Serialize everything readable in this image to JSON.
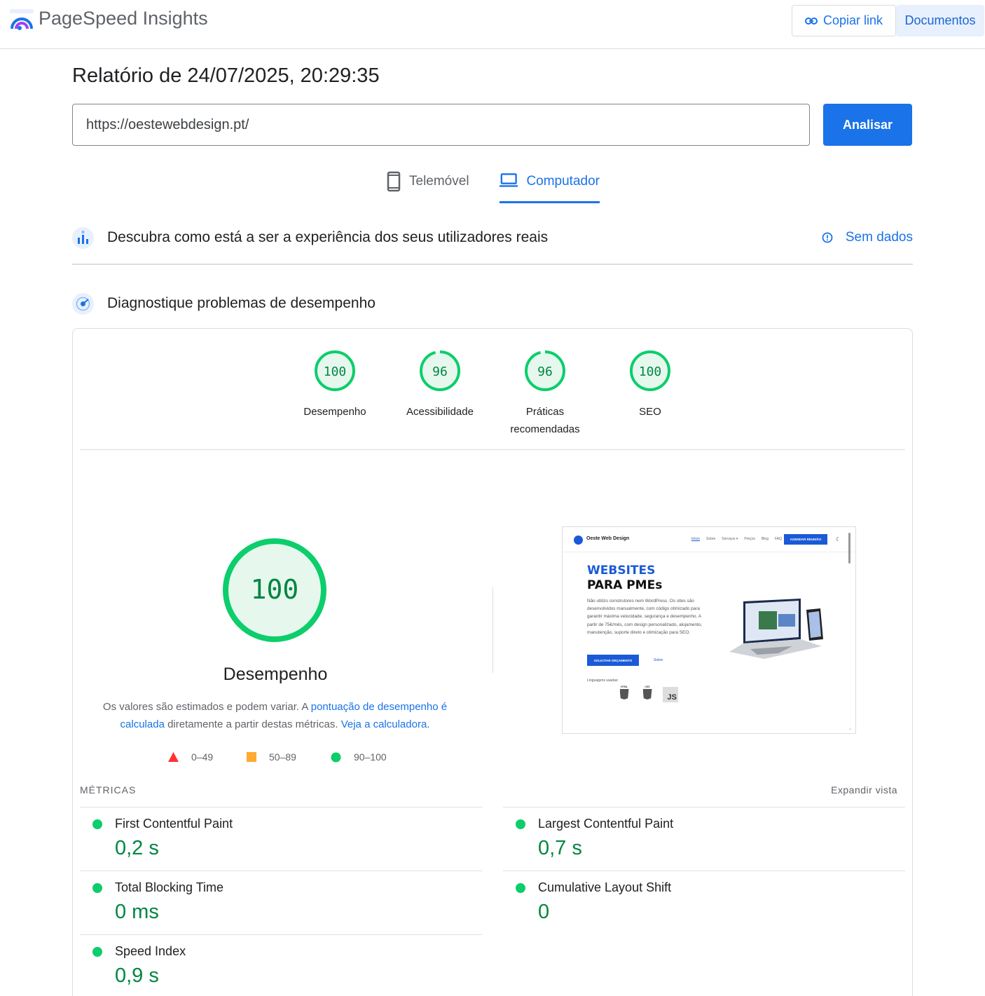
{
  "header": {
    "app_title": "PageSpeed Insights",
    "copy_link_label": "Copiar link",
    "docs_label": "Documentos"
  },
  "report": {
    "title": "Relatório de 24/07/2025, 20:29:35",
    "url_value": "https://oestewebdesign.pt/",
    "analyze_label": "Analisar"
  },
  "tabs": {
    "mobile": "Telemóvel",
    "desktop": "Computador",
    "active": "desktop"
  },
  "field_data": {
    "label": "Descubra como está a ser a experiência dos seus utilizadores reais",
    "status": "Sem dados"
  },
  "diagnostics": {
    "label": "Diagnostique problemas de desempenho"
  },
  "scores": [
    {
      "value": "100",
      "score": 100,
      "label_lines": [
        "Desempenho"
      ]
    },
    {
      "value": "96",
      "score": 96,
      "label_lines": [
        "Acessibilidade"
      ]
    },
    {
      "value": "96",
      "score": 96,
      "label_lines": [
        "Práticas",
        "recomendadas"
      ]
    },
    {
      "value": "100",
      "score": 100,
      "label_lines": [
        "SEO"
      ]
    }
  ],
  "performance": {
    "score": "100",
    "label": "Desempenho",
    "desc_1": "Os valores são estimados e podem variar. A ",
    "desc_link_1": "pontuação de desempenho é calculada",
    "desc_2": " diretamente a partir destas métricas. ",
    "desc_link_2": "Veja a calculadora."
  },
  "legend": [
    {
      "range": "0–49",
      "shape": "triangle",
      "color": "#ff3333"
    },
    {
      "range": "50–89",
      "shape": "square",
      "color": "#ffaa33"
    },
    {
      "range": "90–100",
      "shape": "circle",
      "color": "#0cce6b"
    }
  ],
  "thumbnail": {
    "brand": "Oeste Web Design",
    "nav": [
      "Início",
      "Sobre",
      "Serviços ▾",
      "Preços",
      "Blog",
      "FAQ"
    ],
    "cta": "AGENDAR REUNIÃO",
    "headline_1": "WEBSITES",
    "headline_2": "PARA PMEs",
    "body": "Não utilizo construtores nem WordPress. Os sites são desenvolvidos manualmente, com código otimizado para garantir máxima velocidade, segurança e desempenho. A partir de 75€/mês, com design personalizado, alojamento, manutenção, suporte direto e otimização para SEO.",
    "btn_primary": "SOLICITAR ORÇAMENTO",
    "btn_secondary": "Sobre",
    "languages_label": "Linguagens usadas:",
    "lang_html": "HTML",
    "lang_css": "CSS",
    "lang_js": "JS"
  },
  "metrics": {
    "title": "MÉTRICAS",
    "expand_label": "Expandir vista",
    "items": [
      {
        "name": "First Contentful Paint",
        "value": "0,2 s"
      },
      {
        "name": "Largest Contentful Paint",
        "value": "0,7 s"
      },
      {
        "name": "Total Blocking Time",
        "value": "0 ms"
      },
      {
        "name": "Cumulative Layout Shift",
        "value": "0"
      },
      {
        "name": "Speed Index",
        "value": "0,9 s"
      }
    ]
  },
  "colors": {
    "accent": "#1a73e8",
    "good": "#0cce6b",
    "good_text": "#018642",
    "good_fill": "#e6f8ee"
  }
}
